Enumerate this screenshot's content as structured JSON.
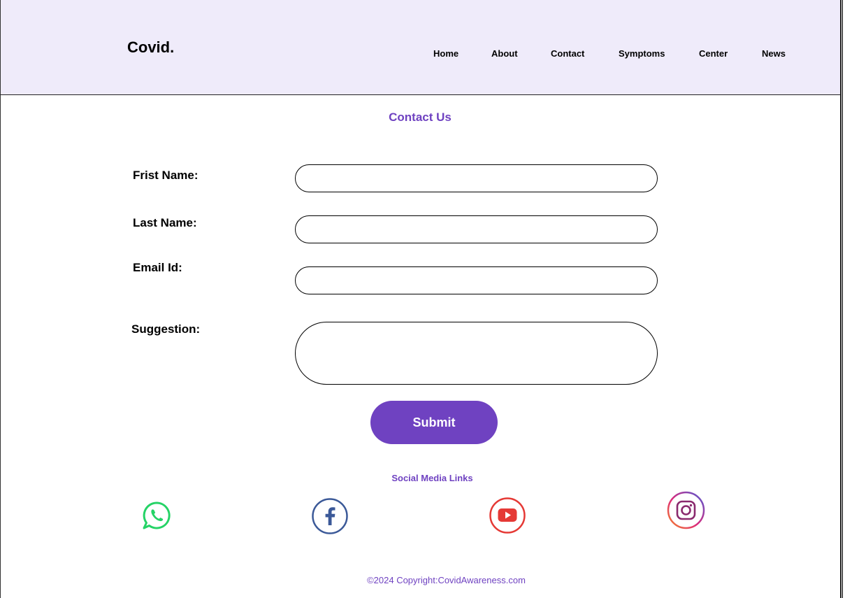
{
  "brand": {
    "logo": "Covid."
  },
  "nav": {
    "items": [
      {
        "label": "Home"
      },
      {
        "label": "About"
      },
      {
        "label": "Contact"
      },
      {
        "label": "Symptoms"
      },
      {
        "label": "Center"
      },
      {
        "label": "News"
      }
    ]
  },
  "contact": {
    "title": "Contact Us",
    "first_name_label": "Frist Name:",
    "last_name_label": "Last Name:",
    "email_label": "Email Id:",
    "suggestion_label": "Suggestion:",
    "first_name_value": "",
    "last_name_value": "",
    "email_value": "",
    "suggestion_value": "",
    "submit_label": "Submit"
  },
  "social": {
    "title": "Social  Media Links",
    "links": [
      {
        "icon": "whatsapp-icon",
        "color": "#25d366"
      },
      {
        "icon": "facebook-icon",
        "color": "#3b5998"
      },
      {
        "icon": "youtube-icon",
        "color": "#e53935"
      },
      {
        "icon": "instagram-icon",
        "color": "#c13584"
      }
    ]
  },
  "footer": {
    "copyright": "©2024 Copyright:CovidAwareness.com"
  },
  "colors": {
    "accent": "#6f42c1",
    "header_bg": "#efebfa"
  }
}
